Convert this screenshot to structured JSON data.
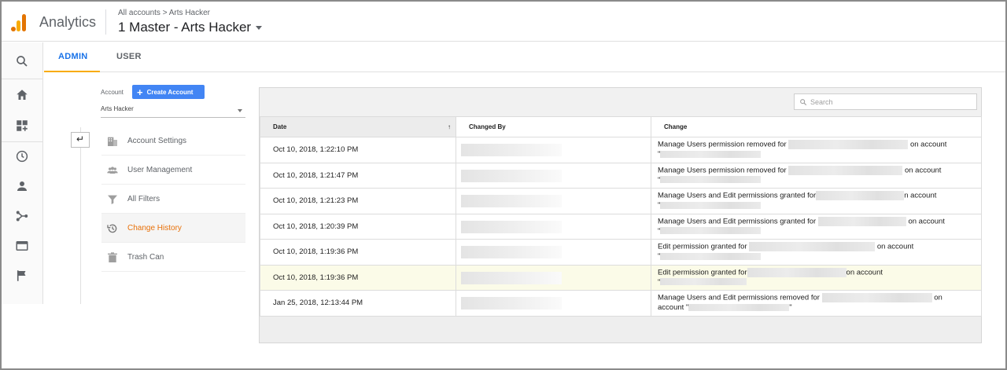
{
  "app": {
    "name": "Analytics",
    "breadcrumb": "All accounts > Arts Hacker",
    "property_title": "1 Master - Arts Hacker"
  },
  "tabs": [
    {
      "label": "ADMIN",
      "active": true
    },
    {
      "label": "USER",
      "active": false
    }
  ],
  "rail": {
    "icons": [
      "search-icon",
      "home-icon",
      "dashboard-icon",
      "clock-icon",
      "person-icon",
      "share-icon",
      "window-icon",
      "flag-icon"
    ]
  },
  "account": {
    "label": "Account",
    "create_label": "Create Account",
    "selected": "Arts Hacker"
  },
  "menu": [
    {
      "label": "Account Settings",
      "icon": "building-icon",
      "active": false
    },
    {
      "label": "User Management",
      "icon": "people-icon",
      "active": false
    },
    {
      "label": "All Filters",
      "icon": "filter-icon",
      "active": false
    },
    {
      "label": "Change History",
      "icon": "history-icon",
      "active": true
    },
    {
      "label": "Trash Can",
      "icon": "trash-icon",
      "active": false
    }
  ],
  "table": {
    "search_placeholder": "Search",
    "columns": [
      "Date",
      "Changed By",
      "Change"
    ],
    "rows": [
      {
        "date": "Oct 10, 2018, 1:22:10 PM",
        "change_a": "Manage Users permission removed for",
        "change_b": "on account",
        "change_c": "\""
      },
      {
        "date": "Oct 10, 2018, 1:21:47 PM",
        "change_a": "Manage Users permission removed for",
        "change_b": "on account",
        "change_c": "\""
      },
      {
        "date": "Oct 10, 2018, 1:21:23 PM",
        "change_a": "Manage Users and Edit permissions granted for",
        "change_b": "n account",
        "change_c": "\""
      },
      {
        "date": "Oct 10, 2018, 1:20:39 PM",
        "change_a": "Manage Users and Edit permissions granted for",
        "change_b": "on account",
        "change_c": "\""
      },
      {
        "date": "Oct 10, 2018, 1:19:36 PM",
        "change_a": "Edit permission granted for",
        "change_b": "on account",
        "change_c": "\""
      },
      {
        "date": "Oct 10, 2018, 1:19:36 PM",
        "change_a": "Edit permission granted for",
        "change_b": "on account",
        "change_c": "\""
      },
      {
        "date": "Jan 25, 2018, 12:13:44 PM",
        "change_a": "Manage Users and Edit permissions removed for",
        "change_b": "on",
        "change_c": "account \""
      }
    ]
  },
  "colors": {
    "accent_blue": "#1a73e8",
    "tab_underline": "#f9ab00",
    "active_menu_text": "#e8710a",
    "button_blue": "#4285f4",
    "highlight_row": "#fbfbe8"
  }
}
